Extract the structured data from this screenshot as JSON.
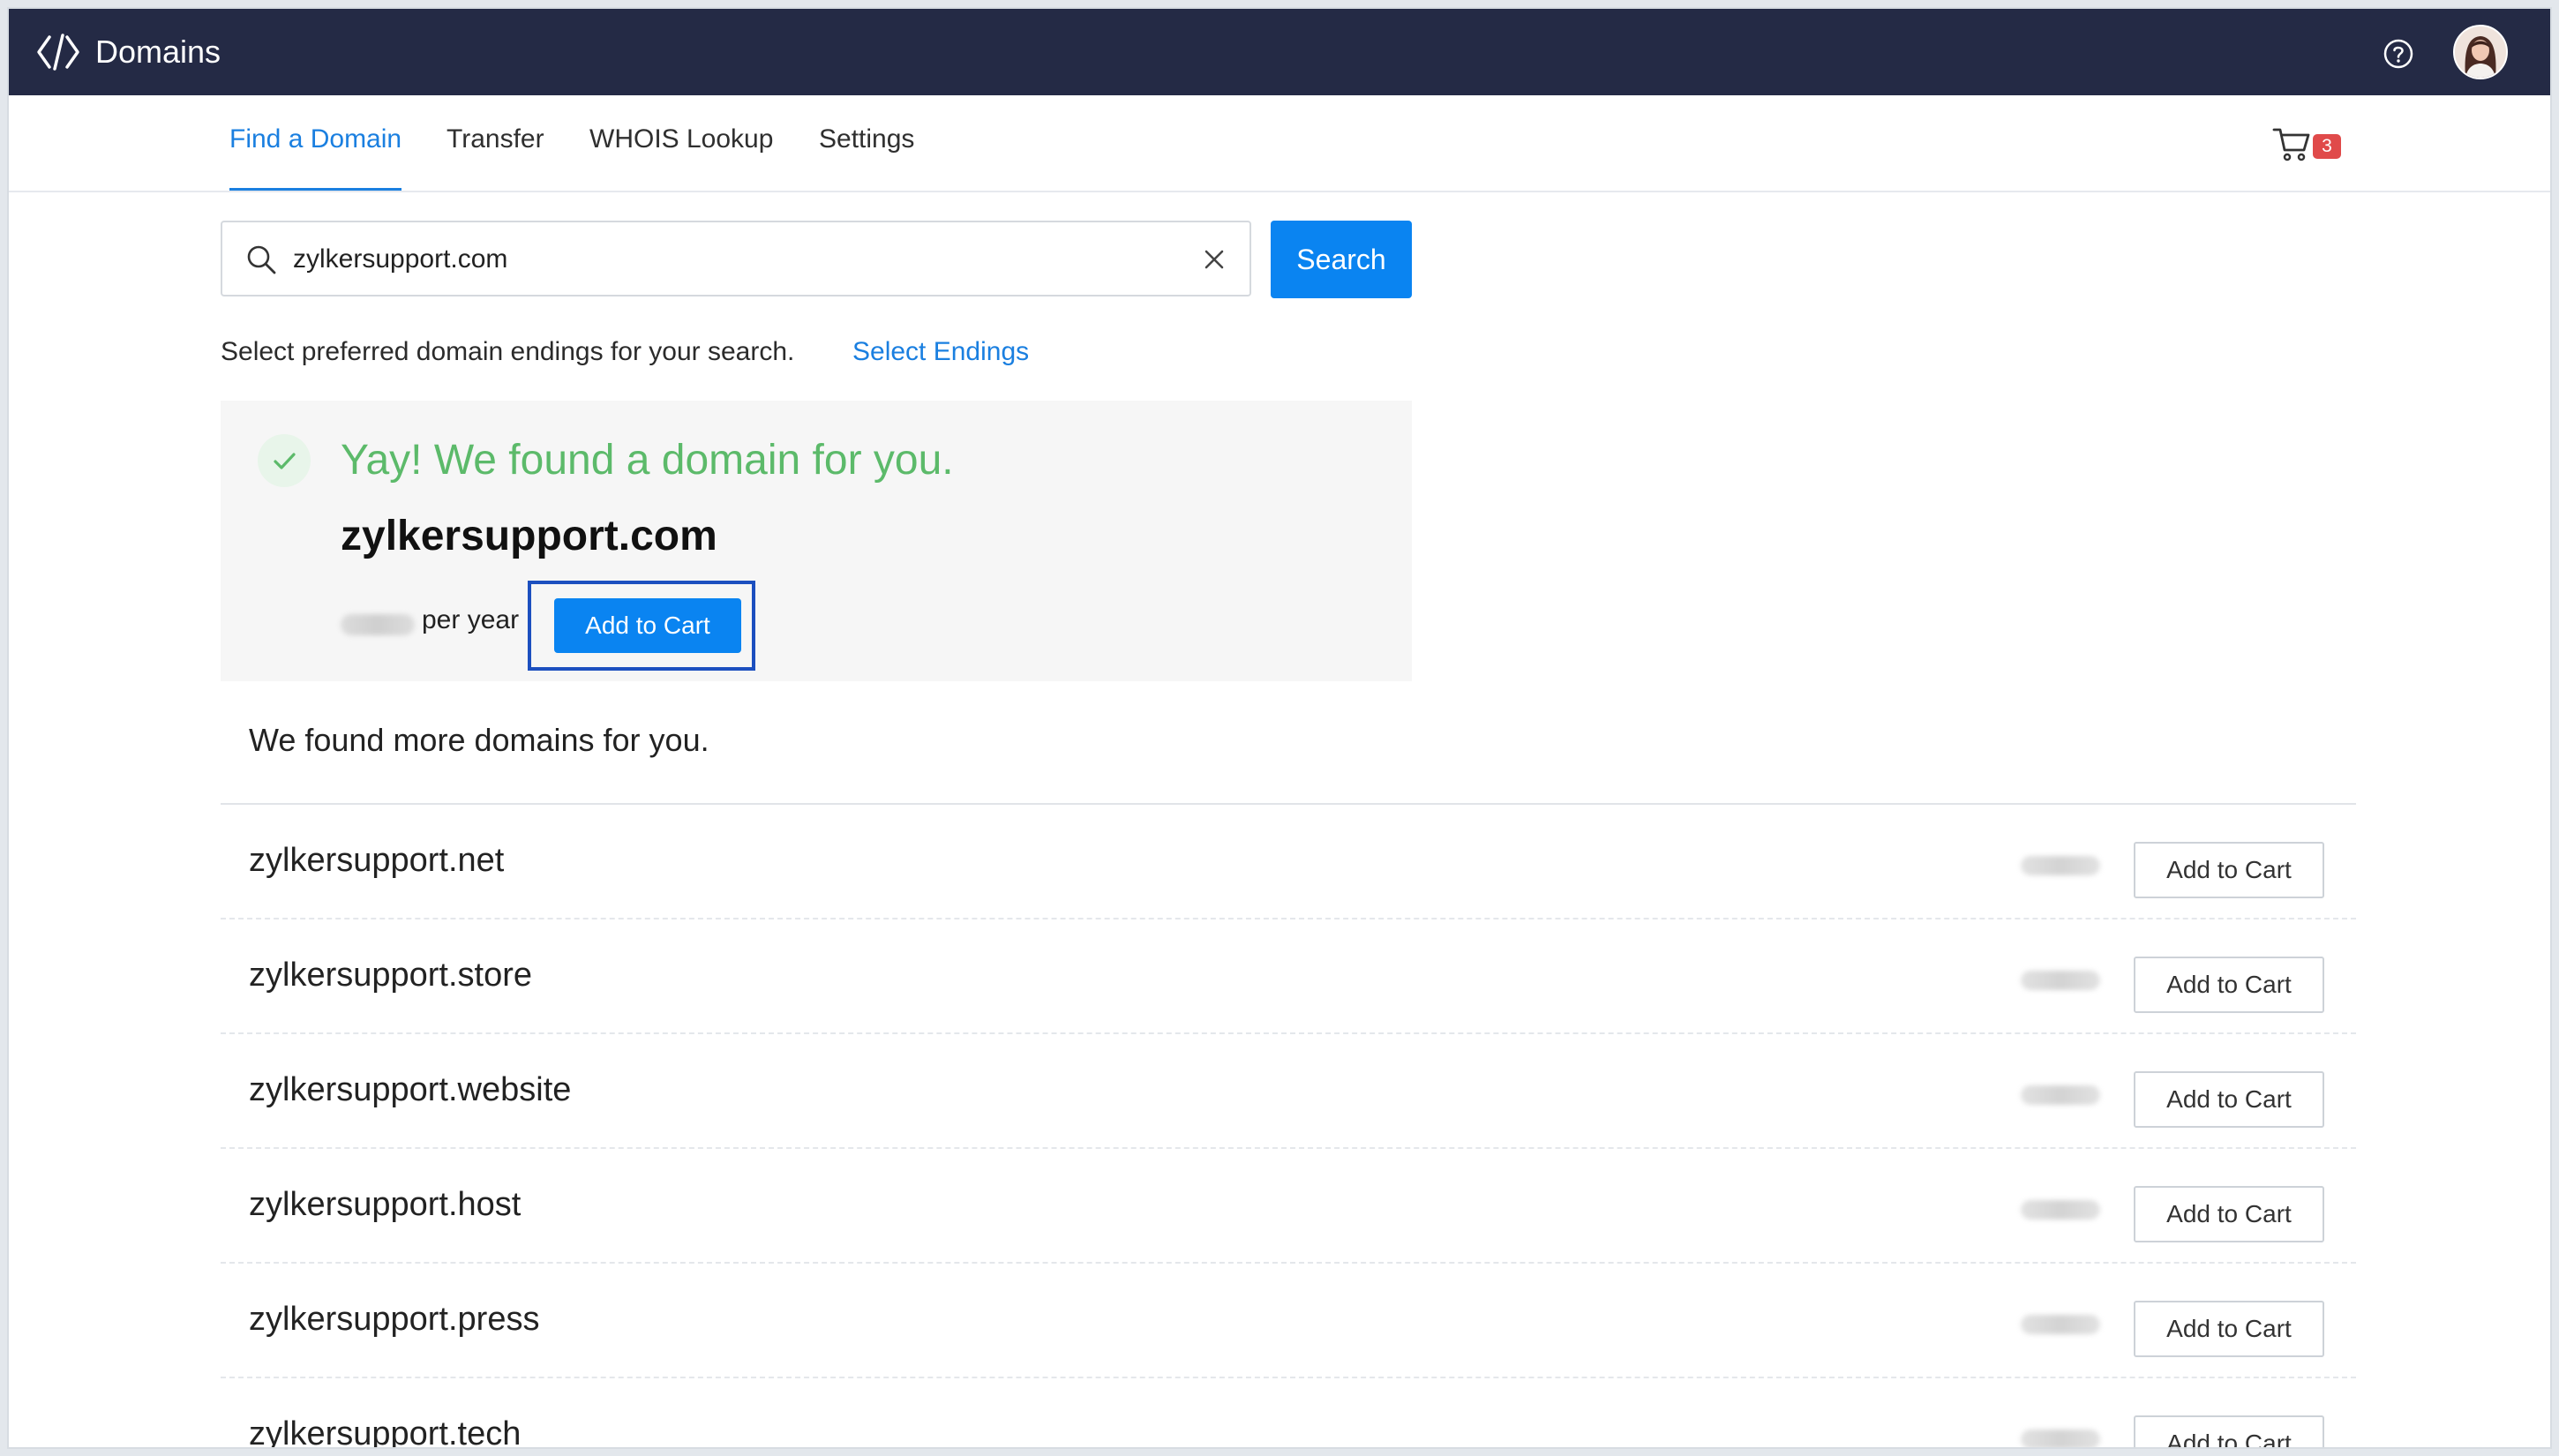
{
  "app": {
    "title": "Domains"
  },
  "nav": {
    "tabs": [
      {
        "label": "Find a Domain",
        "active": true
      },
      {
        "label": "Transfer",
        "active": false
      },
      {
        "label": "WHOIS Lookup",
        "active": false
      },
      {
        "label": "Settings",
        "active": false
      }
    ],
    "cart_count": "3"
  },
  "search": {
    "value": "zylkersupport.com",
    "button_label": "Search",
    "hint": "Select preferred domain endings for your search.",
    "select_endings": "Select Endings"
  },
  "found": {
    "headline": "Yay! We found a domain for you.",
    "domain": "zylkersupport.com",
    "per_year": "per year",
    "add_label": "Add to Cart"
  },
  "more": {
    "title": "We found more domains for you.",
    "add_label": "Add to Cart",
    "rows": [
      {
        "domain": "zylkersupport.net"
      },
      {
        "domain": "zylkersupport.store"
      },
      {
        "domain": "zylkersupport.website"
      },
      {
        "domain": "zylkersupport.host"
      },
      {
        "domain": "zylkersupport.press"
      },
      {
        "domain": "zylkersupport.tech"
      }
    ]
  },
  "colors": {
    "appbar": "#242a45",
    "accent": "#0a84f1",
    "success": "#5cba6a",
    "badge": "#e04a4a",
    "focus_ring": "#1c4fbf"
  },
  "icons": {
    "logo": "domains-logo-icon",
    "help": "help-icon",
    "cart": "cart-icon",
    "search": "search-icon",
    "clear": "close-icon",
    "success": "check-circle-icon"
  }
}
